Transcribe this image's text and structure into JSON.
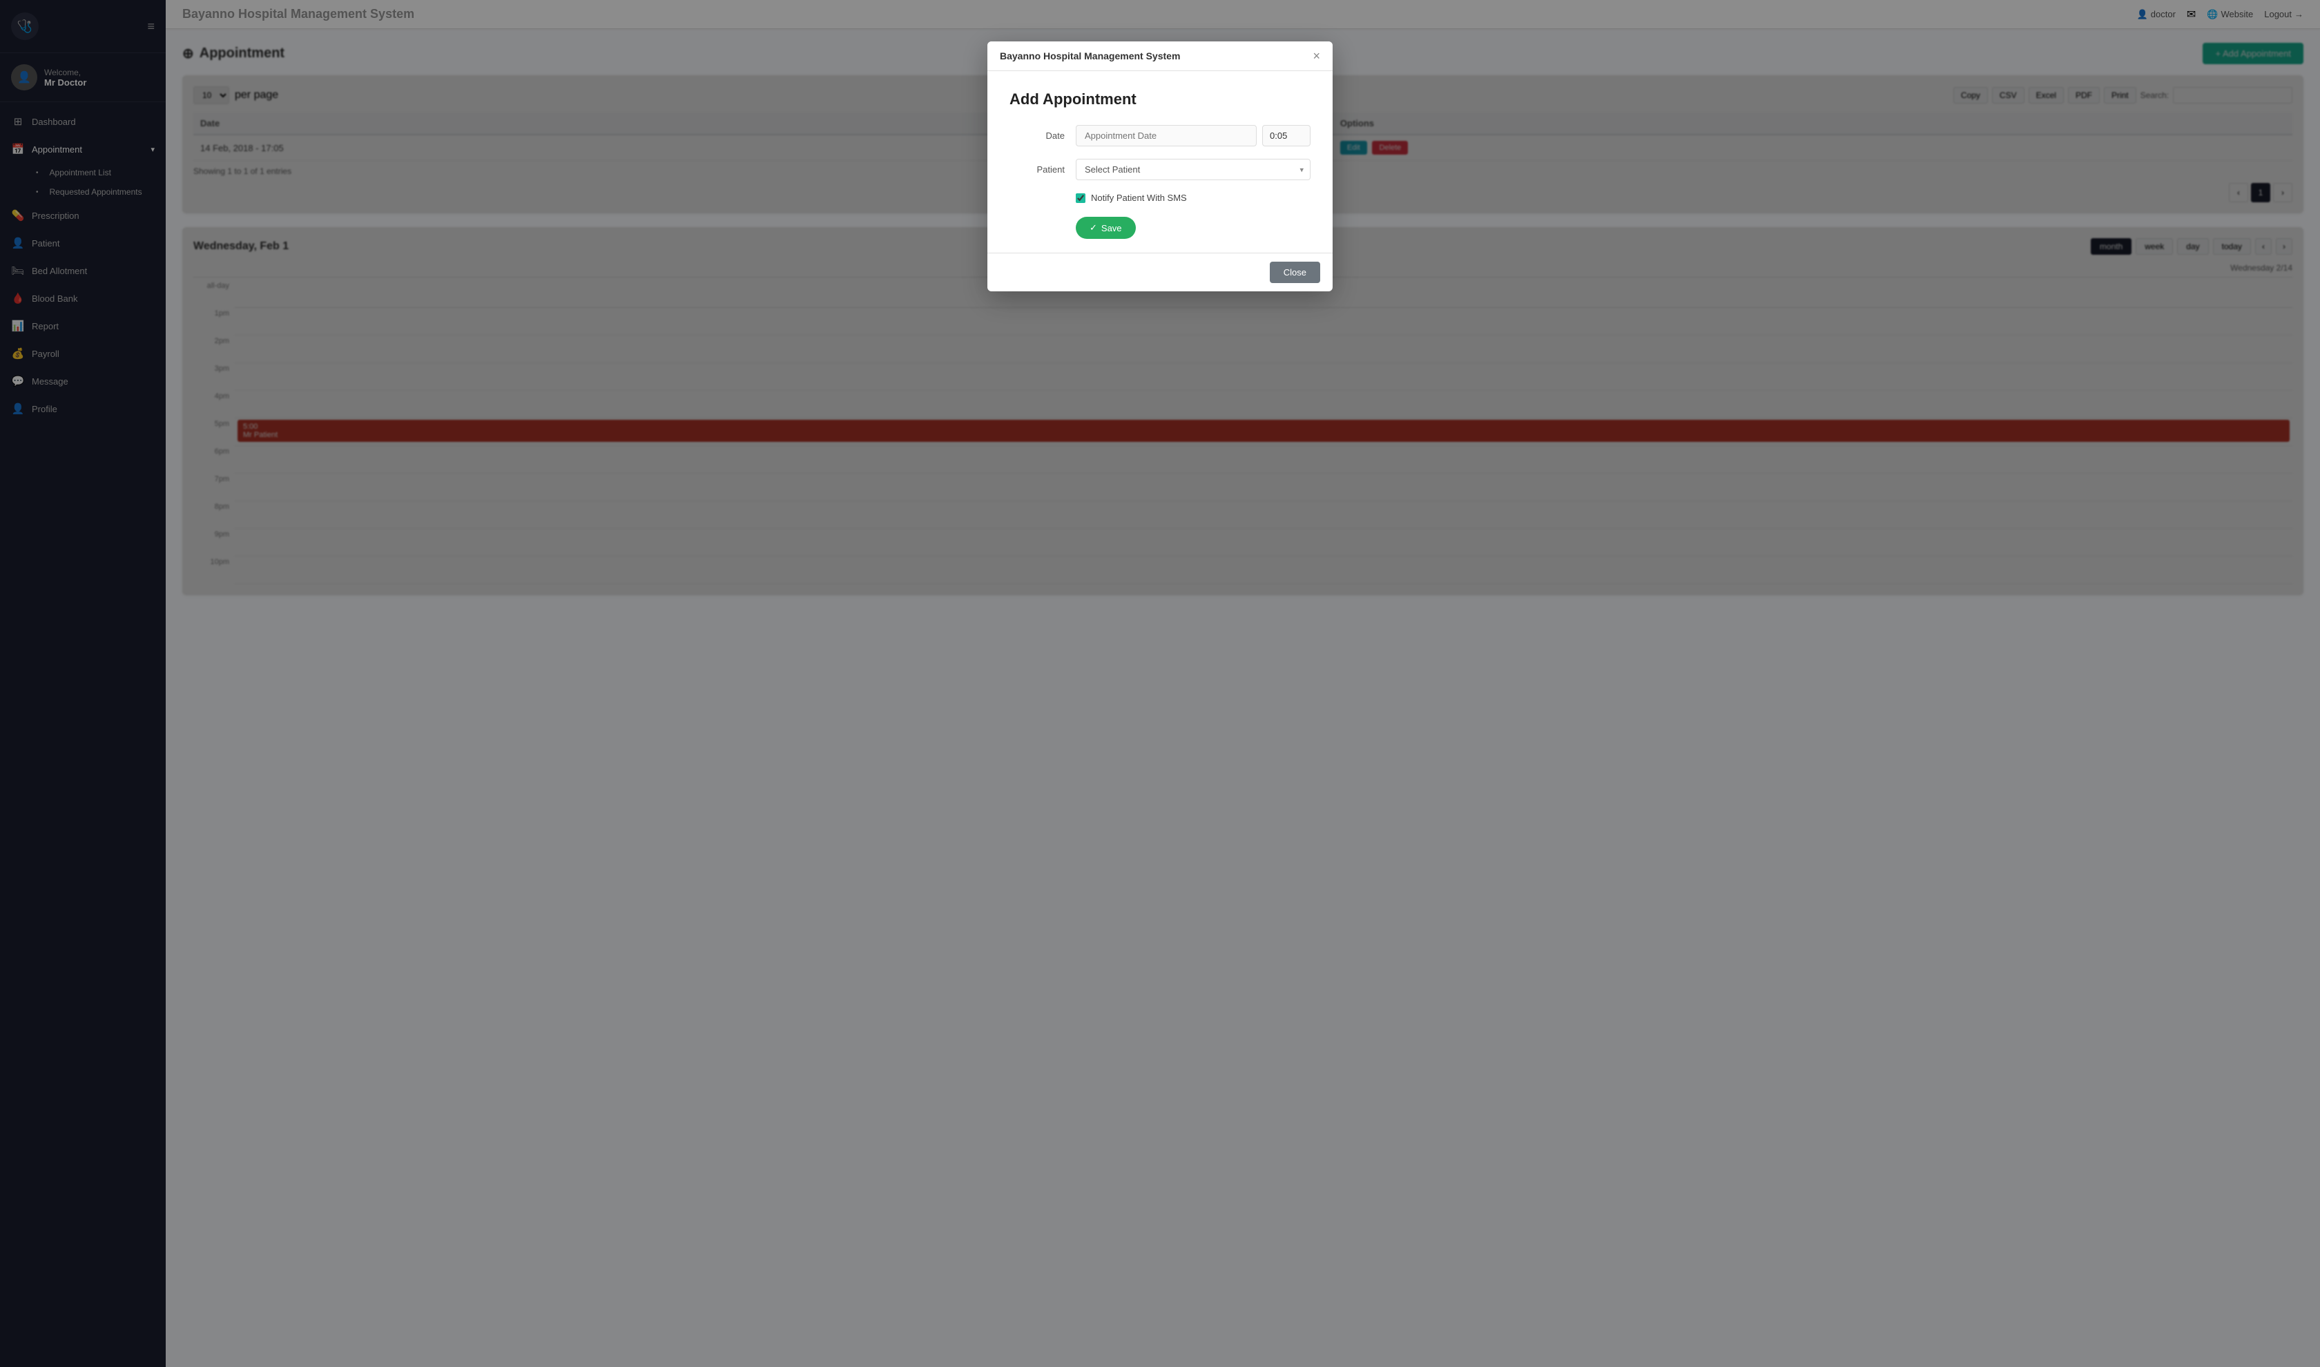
{
  "app": {
    "title": "Bayanno Hospital Management System",
    "topbar_title": "Bayanno Hospital Management System"
  },
  "sidebar": {
    "logo_icon": "🩺",
    "hamburger_icon": "≡",
    "welcome_text": "Welcome,",
    "welcome_name": "Mr Doctor",
    "avatar_icon": "👤",
    "nav_items": [
      {
        "id": "dashboard",
        "label": "Dashboard",
        "icon": "⊞"
      },
      {
        "id": "appointment",
        "label": "Appointment",
        "icon": "📅",
        "has_arrow": true,
        "active": true
      },
      {
        "id": "appointment-list",
        "label": "Appointment List",
        "sub": true
      },
      {
        "id": "requested-appointments",
        "label": "Requested Appointments",
        "sub": true
      },
      {
        "id": "prescription",
        "label": "Prescription",
        "icon": "💊"
      },
      {
        "id": "patient",
        "label": "Patient",
        "icon": "👤"
      },
      {
        "id": "bed-allotment",
        "label": "Bed Allotment",
        "icon": "🛏"
      },
      {
        "id": "blood-bank",
        "label": "Blood Bank",
        "icon": "🩸"
      },
      {
        "id": "report",
        "label": "Report",
        "icon": "📊"
      },
      {
        "id": "payroll",
        "label": "Payroll",
        "icon": "💰"
      },
      {
        "id": "message",
        "label": "Message",
        "icon": "💬"
      },
      {
        "id": "profile",
        "label": "Profile",
        "icon": "👤"
      }
    ]
  },
  "topbar": {
    "user_icon": "👤",
    "user_label": "doctor",
    "mail_icon": "✉",
    "website_icon": "🌐",
    "website_label": "Website",
    "logout_icon": "→",
    "logout_label": "Logout"
  },
  "page": {
    "title": "Appointment",
    "title_icon": "⊕",
    "add_btn_label": "+ Add Appointment"
  },
  "table": {
    "per_page_value": "10",
    "per_page_label": "per page",
    "copy_label": "Copy",
    "csv_label": "CSV",
    "excel_label": "Excel",
    "pdf_label": "PDF",
    "print_label": "Print",
    "search_label": "Search:",
    "col_date": "Date",
    "col_options": "Options",
    "rows": [
      {
        "date": "14 Feb, 2018 - 17:05"
      }
    ],
    "showing_text": "Showing 1 to 1 of 1 entries",
    "edit_label": "Edit",
    "delete_label": "Delete",
    "pagination_prev": "‹",
    "pagination_page": "1",
    "pagination_next": "›"
  },
  "calendar": {
    "title": "Wednesday, Feb 1",
    "btn_month": "month",
    "btn_week": "week",
    "btn_day": "day",
    "btn_today": "today",
    "nav_prev": "‹",
    "nav_next": "›",
    "day_label": "Wednesday 2/14",
    "allday_label": "all-day",
    "times": [
      "1pm",
      "2pm",
      "3pm",
      "4pm",
      "5pm",
      "6pm",
      "7pm",
      "8pm",
      "9pm",
      "10pm"
    ],
    "event_time": "5:00",
    "event_label": "Mr Patient"
  },
  "modal": {
    "header_title": "Bayanno Hospital Management System",
    "close_icon": "×",
    "form_title": "Add Appointment",
    "date_label": "Date",
    "date_placeholder": "Appointment Date",
    "time_value": "0:05",
    "patient_label": "Patient",
    "patient_placeholder": "Select Patient",
    "notify_label": "Notify Patient With SMS",
    "save_label": "Save",
    "save_icon": "✓",
    "close_label": "Close"
  }
}
